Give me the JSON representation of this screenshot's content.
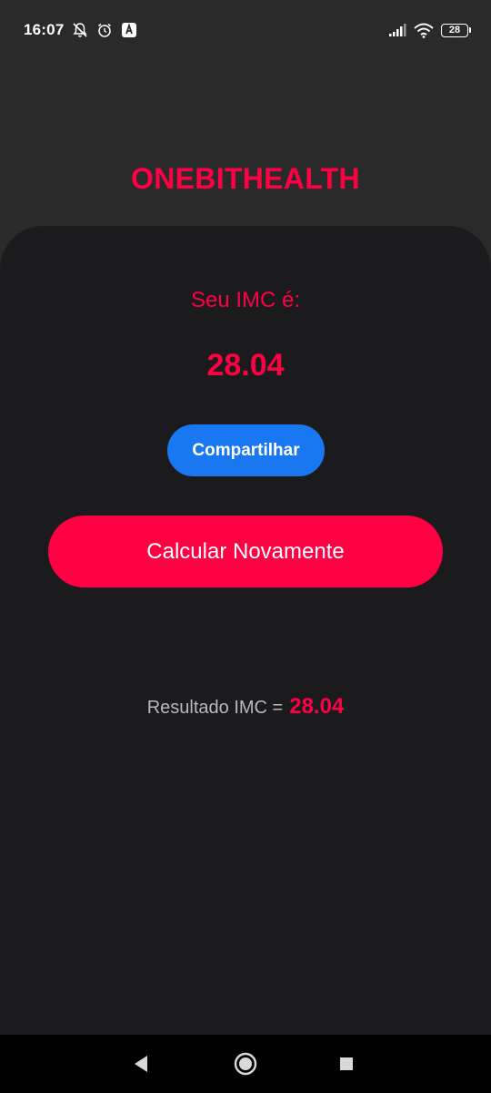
{
  "status_bar": {
    "time": "16:07",
    "battery_level": "28",
    "icons": [
      "notifications-off-icon",
      "alarm-clock-icon",
      "app-notification-icon",
      "signal-icon",
      "wifi-icon",
      "battery-icon"
    ]
  },
  "app": {
    "title": "ONEBITHEALTH"
  },
  "result": {
    "label": "Seu IMC é:",
    "value": "28.04",
    "share_label": "Compartilhar",
    "recalc_label": "Calcular Novamente",
    "summary_label": "Resultado IMC =",
    "summary_value": "28.04"
  },
  "colors": {
    "accent": "#ff0043",
    "share_button": "#1a77f2",
    "background": "#2a2a2b",
    "card": "#1b1b1d"
  },
  "nav_bar": {
    "icons": [
      "back-icon",
      "home-icon",
      "recents-icon"
    ]
  }
}
